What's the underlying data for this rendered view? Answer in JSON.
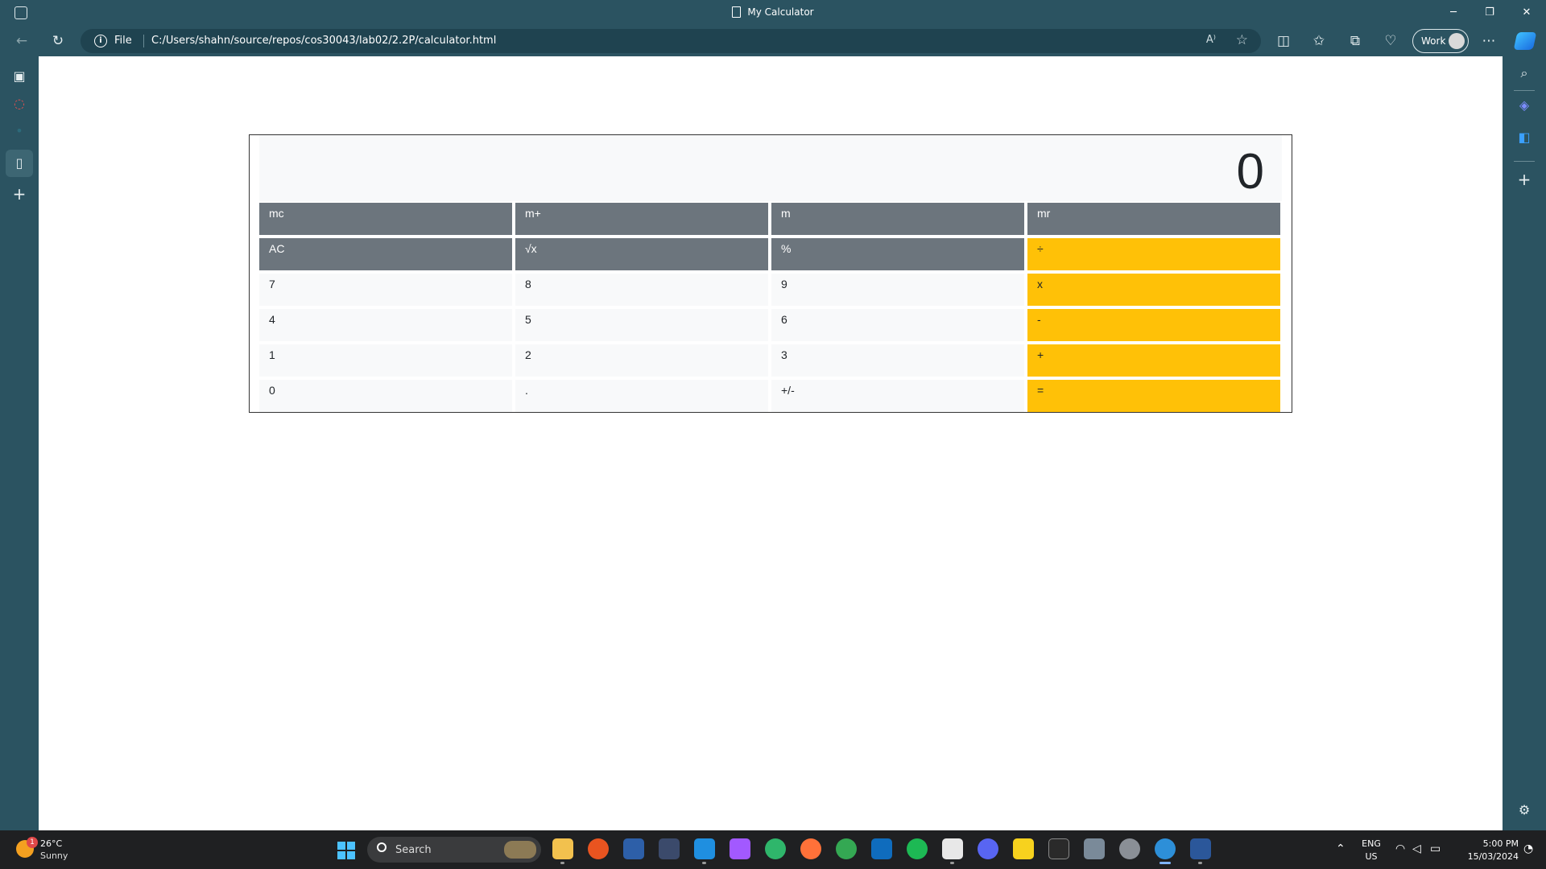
{
  "window": {
    "title": "My Calculator"
  },
  "address_bar": {
    "scheme_label": "File",
    "url": "C:/Users/shahn/source/repos/cos30043/lab02/2.2P/calculator.html"
  },
  "profile": {
    "label": "Work"
  },
  "calculator": {
    "display": "0",
    "rows": [
      [
        {
          "label": "mc",
          "style": "gray"
        },
        {
          "label": "m+",
          "style": "gray"
        },
        {
          "label": "m",
          "style": "gray"
        },
        {
          "label": "mr",
          "style": "gray"
        }
      ],
      [
        {
          "label": "AC",
          "style": "gray"
        },
        {
          "label": "√x",
          "style": "gray"
        },
        {
          "label": "%",
          "style": "gray"
        },
        {
          "label": "÷",
          "style": "yellow"
        }
      ],
      [
        {
          "label": "7",
          "style": "light"
        },
        {
          "label": "8",
          "style": "light"
        },
        {
          "label": "9",
          "style": "light"
        },
        {
          "label": "x",
          "style": "yellow"
        }
      ],
      [
        {
          "label": "4",
          "style": "light"
        },
        {
          "label": "5",
          "style": "light"
        },
        {
          "label": "6",
          "style": "light"
        },
        {
          "label": "-",
          "style": "yellow"
        }
      ],
      [
        {
          "label": "1",
          "style": "light"
        },
        {
          "label": "2",
          "style": "light"
        },
        {
          "label": "3",
          "style": "light"
        },
        {
          "label": "+",
          "style": "yellow"
        }
      ],
      [
        {
          "label": "0",
          "style": "light"
        },
        {
          "label": ".",
          "style": "light"
        },
        {
          "label": "+/-",
          "style": "light"
        },
        {
          "label": "=",
          "style": "yellow"
        }
      ]
    ],
    "colors": {
      "gray": "#6c757d",
      "light": "#f8f9fa",
      "yellow": "#ffc107"
    }
  },
  "taskbar": {
    "weather_temp": "26°C",
    "weather_desc": "Sunny",
    "weather_badge": "1",
    "search_label": "Search",
    "language": "ENG",
    "region": "US",
    "time": "5:00 PM",
    "date": "15/03/2024",
    "apps": [
      "file-explorer",
      "ubuntu",
      "powershell",
      "visual-studio",
      "vscode",
      "figma",
      "edge-beta",
      "firefox",
      "chrome",
      "outlook",
      "spotify",
      "slack",
      "discord",
      "sticky-notes",
      "epic-games",
      "news",
      "settings",
      "edge",
      "word"
    ]
  }
}
